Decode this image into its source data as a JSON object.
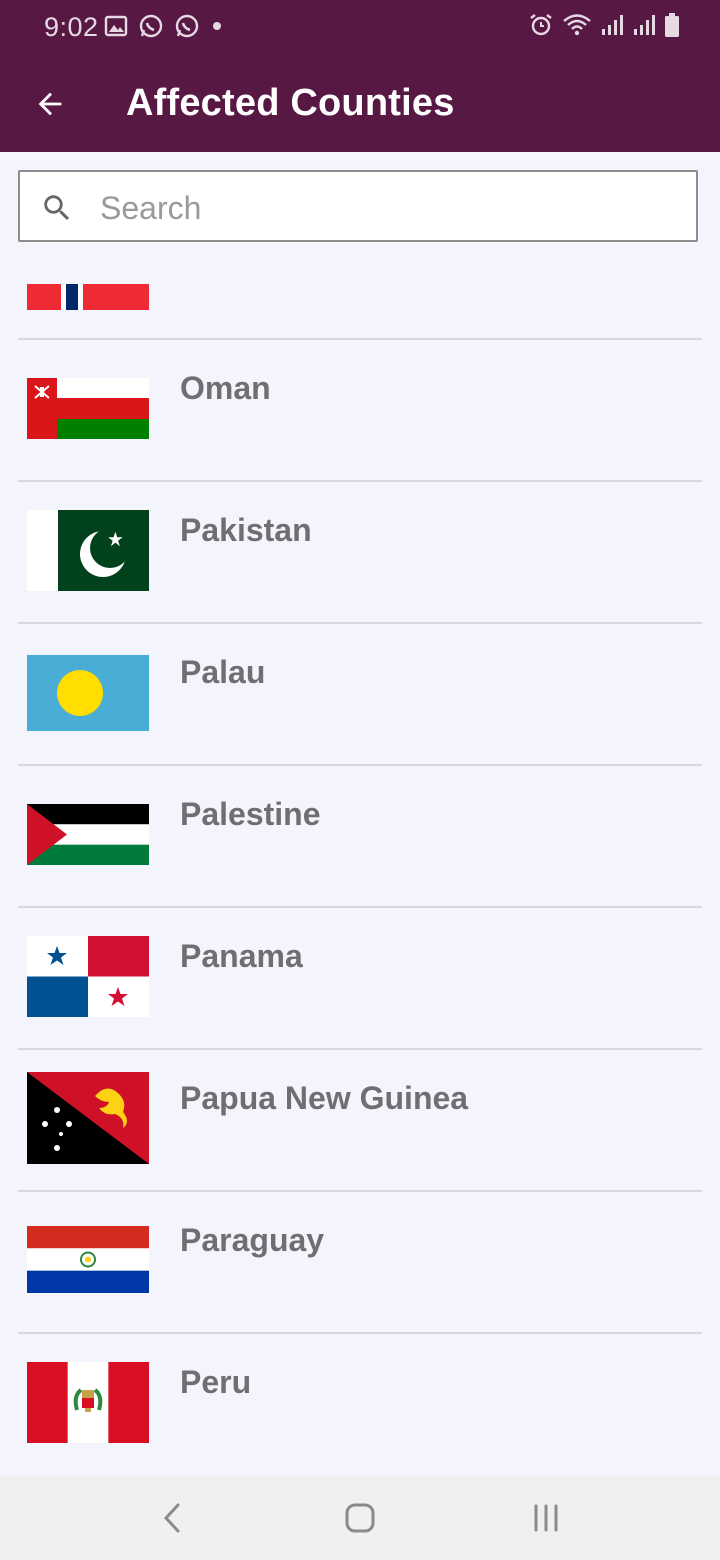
{
  "status_bar": {
    "time": "9:02"
  },
  "header": {
    "title": "Affected Counties"
  },
  "search": {
    "placeholder": "Search",
    "value": ""
  },
  "countries": [
    {
      "name": "",
      "flag": "partial-flag-icon"
    },
    {
      "name": "Oman",
      "flag": "oman-flag-icon"
    },
    {
      "name": "Pakistan",
      "flag": "pakistan-flag-icon"
    },
    {
      "name": "Palau",
      "flag": "palau-flag-icon"
    },
    {
      "name": "Palestine",
      "flag": "palestine-flag-icon"
    },
    {
      "name": "Panama",
      "flag": "panama-flag-icon"
    },
    {
      "name": "Papua New Guinea",
      "flag": "papua-new-guinea-flag-icon"
    },
    {
      "name": "Paraguay",
      "flag": "paraguay-flag-icon"
    },
    {
      "name": "Peru",
      "flag": "peru-flag-icon"
    }
  ],
  "colors": {
    "appbar": "#571944",
    "background": "#f4f5fc",
    "text": "#6f6f73"
  }
}
